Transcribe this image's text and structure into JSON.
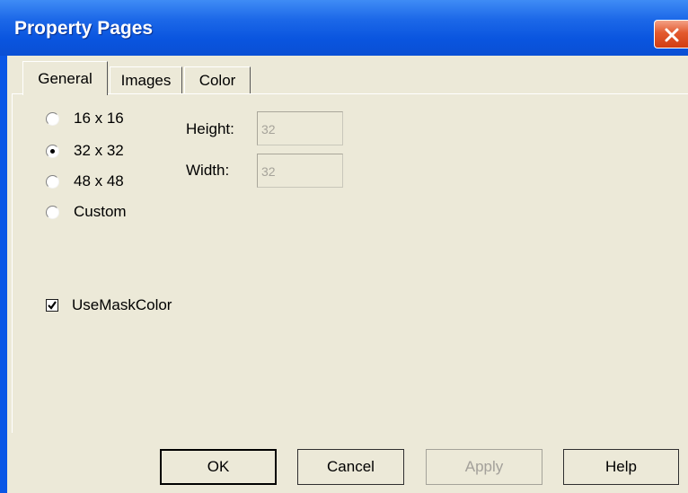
{
  "window": {
    "title": "Property Pages"
  },
  "tabs": [
    {
      "label": "General",
      "active": true
    },
    {
      "label": "Images",
      "active": false
    },
    {
      "label": "Color",
      "active": false
    }
  ],
  "size_options": [
    {
      "label": "16 x 16",
      "checked": false
    },
    {
      "label": "32 x 32",
      "checked": true
    },
    {
      "label": "48 x 48",
      "checked": false
    },
    {
      "label": "Custom",
      "checked": false
    }
  ],
  "fields": {
    "height": {
      "label": "Height:",
      "value": "32"
    },
    "width": {
      "label": "Width:",
      "value": "32"
    }
  },
  "use_mask_color": {
    "label": "UseMaskColor",
    "checked": true
  },
  "buttons": {
    "ok": "OK",
    "cancel": "Cancel",
    "apply": "Apply",
    "help": "Help"
  },
  "icons": {
    "close": "close-icon",
    "check": "checkmark-icon"
  },
  "colors": {
    "titlebar": "#0a57e6",
    "dialog_face": "#ece9d8",
    "close_button": "#e35a2e",
    "disabled_text": "#a3a09a"
  }
}
